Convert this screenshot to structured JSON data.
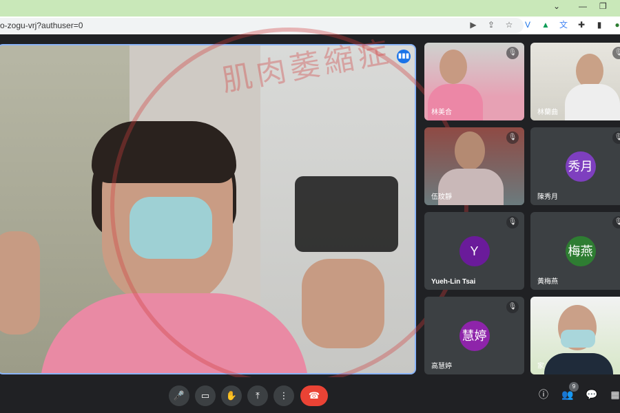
{
  "browser": {
    "url": "o-zogu-vrj?authuser=0",
    "window_controls": [
      "chevron-down",
      "minimize",
      "restore"
    ]
  },
  "meeting": {
    "main_tile": {
      "speaking_icon": "audio-wave"
    },
    "participants": [
      {
        "name": "林美合",
        "muted": true,
        "video": true
      },
      {
        "name": "林蘭曲",
        "muted": true,
        "video": true
      },
      {
        "name": "伍玟靜",
        "muted": true,
        "video": true
      },
      {
        "name": "陳秀月",
        "muted": true,
        "video": false,
        "initial": "秀月",
        "avatar_color": "#7e3fbf"
      },
      {
        "name": "Yueh-Lin Tsai",
        "muted": true,
        "video": false,
        "initial": "Y",
        "avatar_color": "#6a1b9a"
      },
      {
        "name": "黃梅燕",
        "muted": true,
        "video": false,
        "initial": "梅燕",
        "avatar_color": "#2e7d32"
      },
      {
        "name": "高慧婷",
        "muted": true,
        "video": false,
        "initial": "慧婷",
        "avatar_color": "#8e24aa"
      },
      {
        "name": "家",
        "muted": false,
        "video": true
      }
    ],
    "participant_count": "9"
  },
  "watermark": {
    "text": "肌肉萎縮症"
  },
  "colors": {
    "accent": "#8ab4f8",
    "end_call": "#ea4335",
    "tile_bg": "#3c4043"
  }
}
